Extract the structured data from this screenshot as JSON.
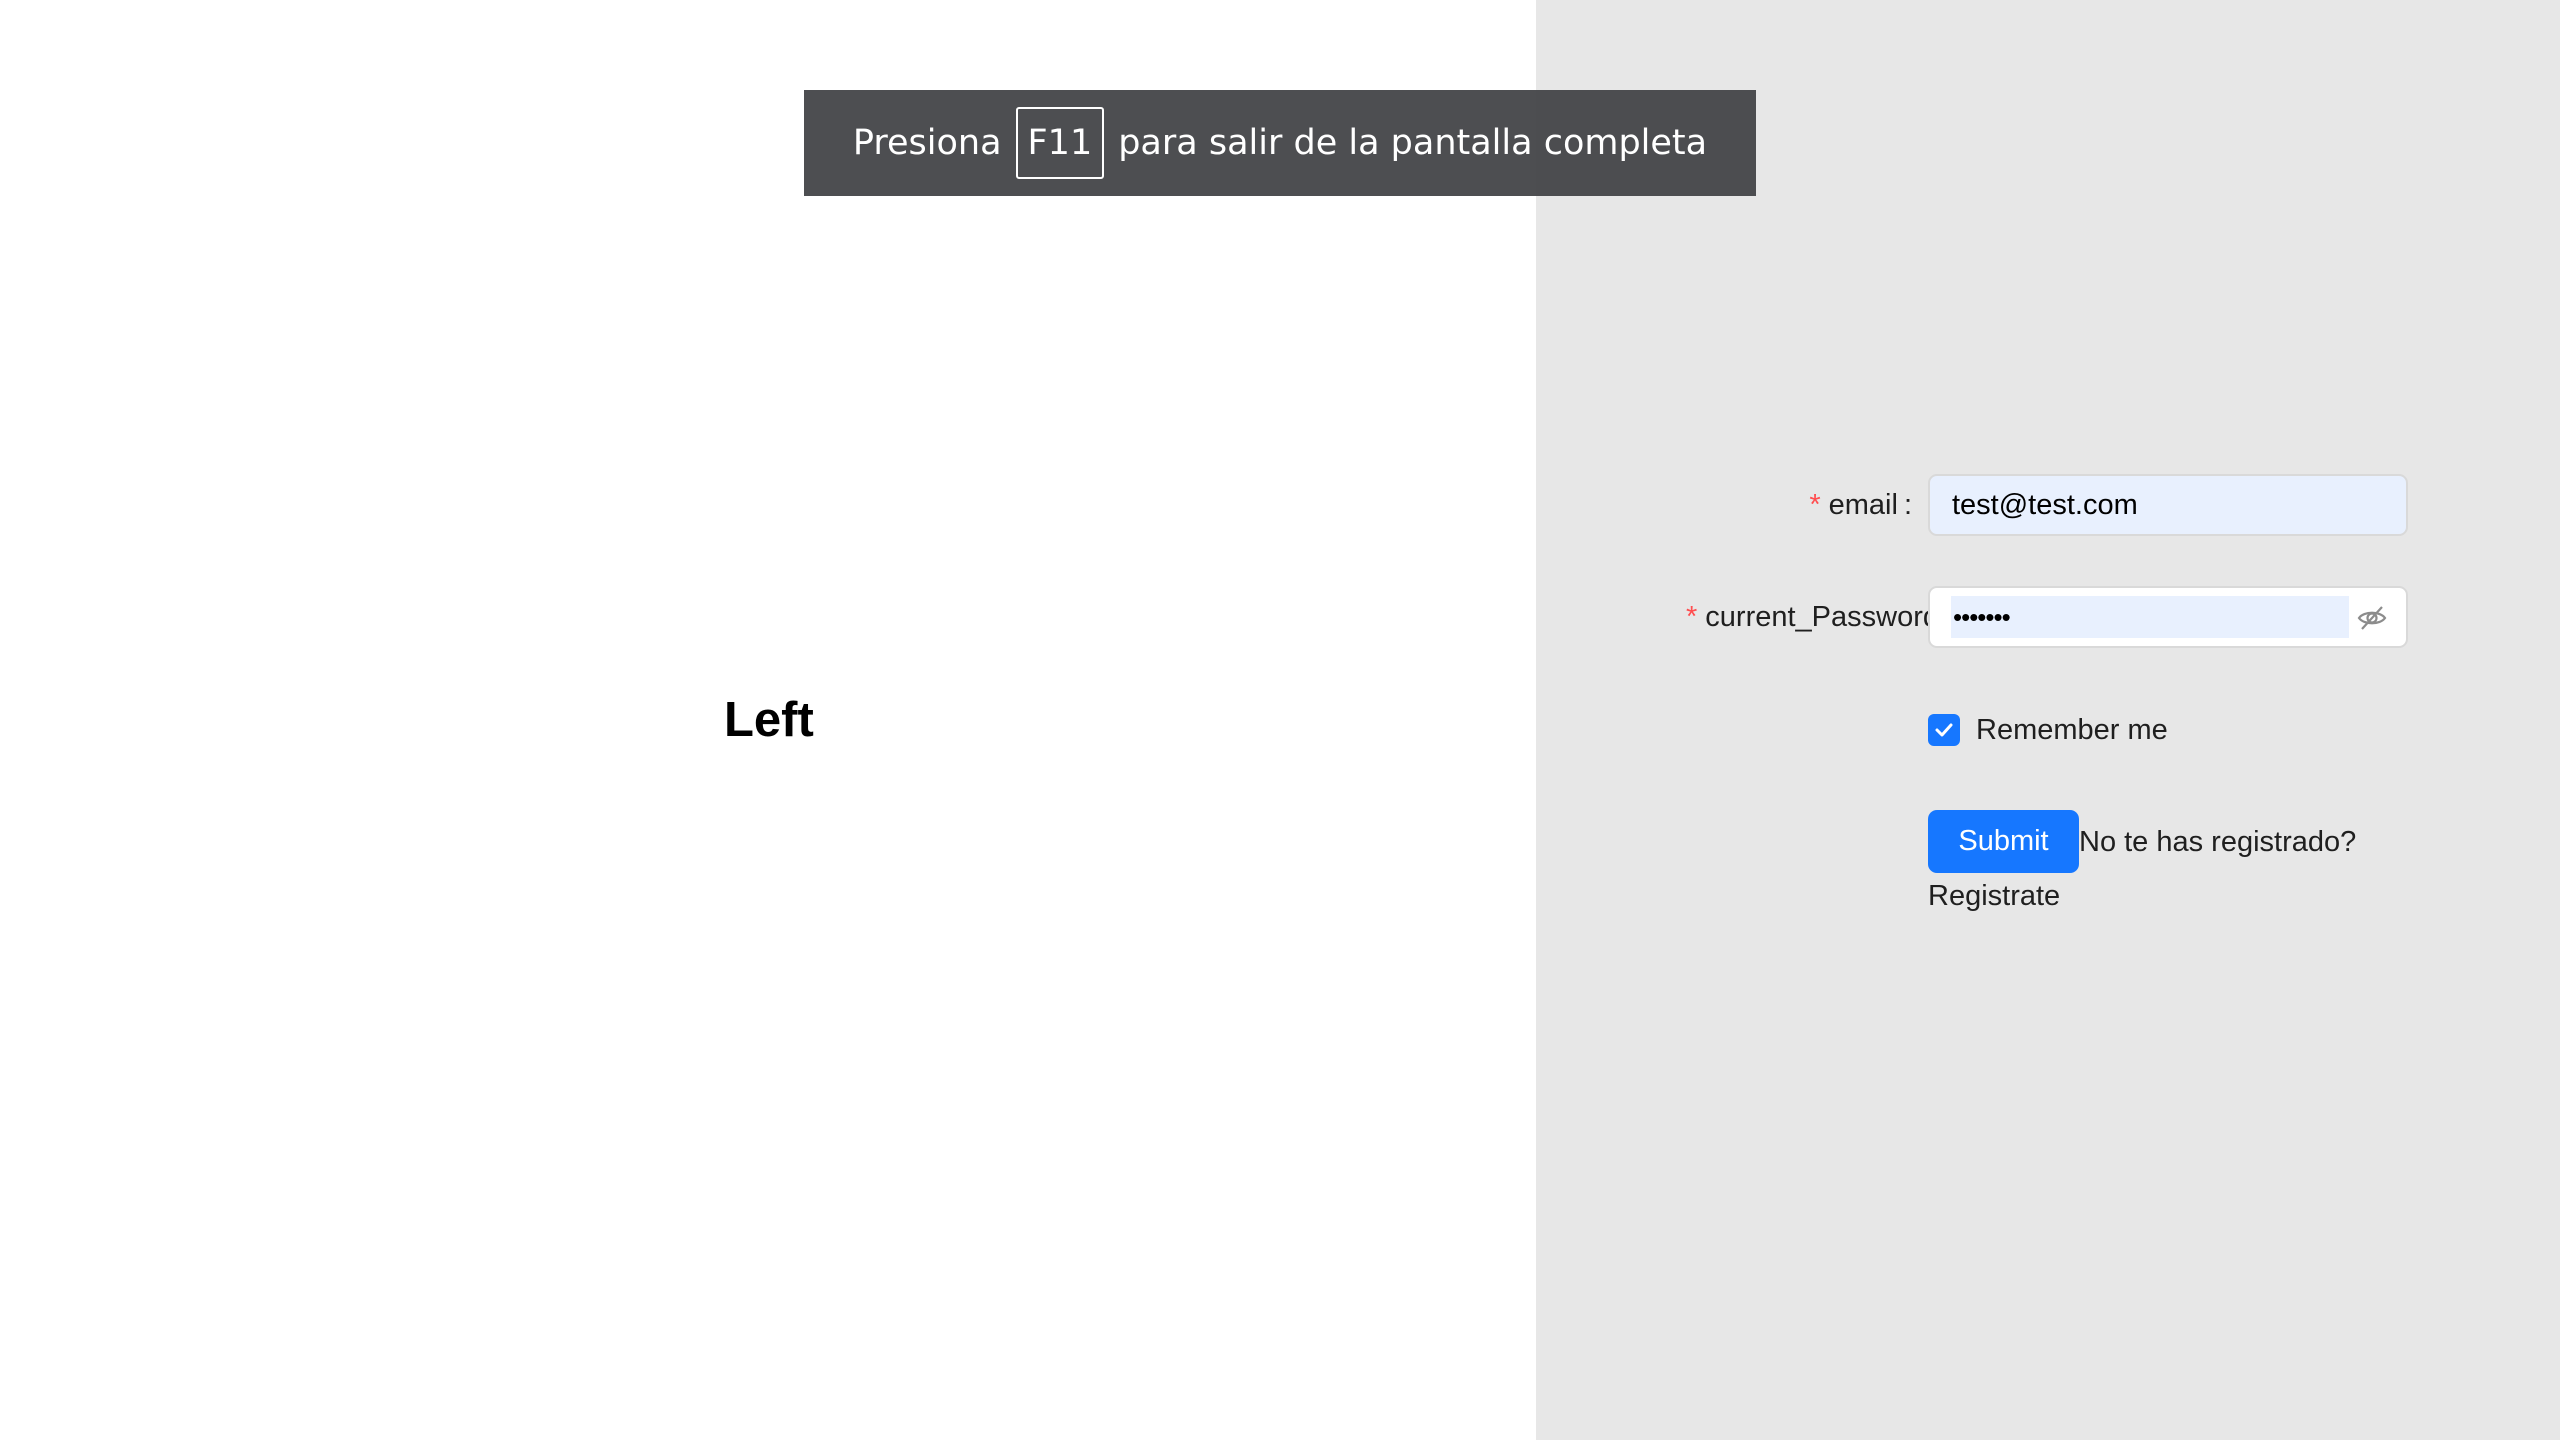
{
  "banner": {
    "prefix": "Presiona",
    "key": "F11",
    "suffix": "para salir de la pantalla completa"
  },
  "left": {
    "title": "Left"
  },
  "form": {
    "email_label": "email",
    "email_colon": ":",
    "email_value": "test@test.com",
    "password_label": "current_Password",
    "password_mask": "•••••••",
    "required_mark": "*",
    "remember_label": "Remember me",
    "remember_checked": true,
    "submit_label": "Submit",
    "register_question": "No te has registrado?",
    "register_link": "Registrate"
  },
  "colors": {
    "accent": "#1677ff",
    "required": "#ff4d4f",
    "right_bg": "#e7e7e7",
    "autofill_bg": "#e8f0fe"
  },
  "icons": {
    "password_toggle": "eye-invisible-icon",
    "checkbox": "check-icon"
  }
}
